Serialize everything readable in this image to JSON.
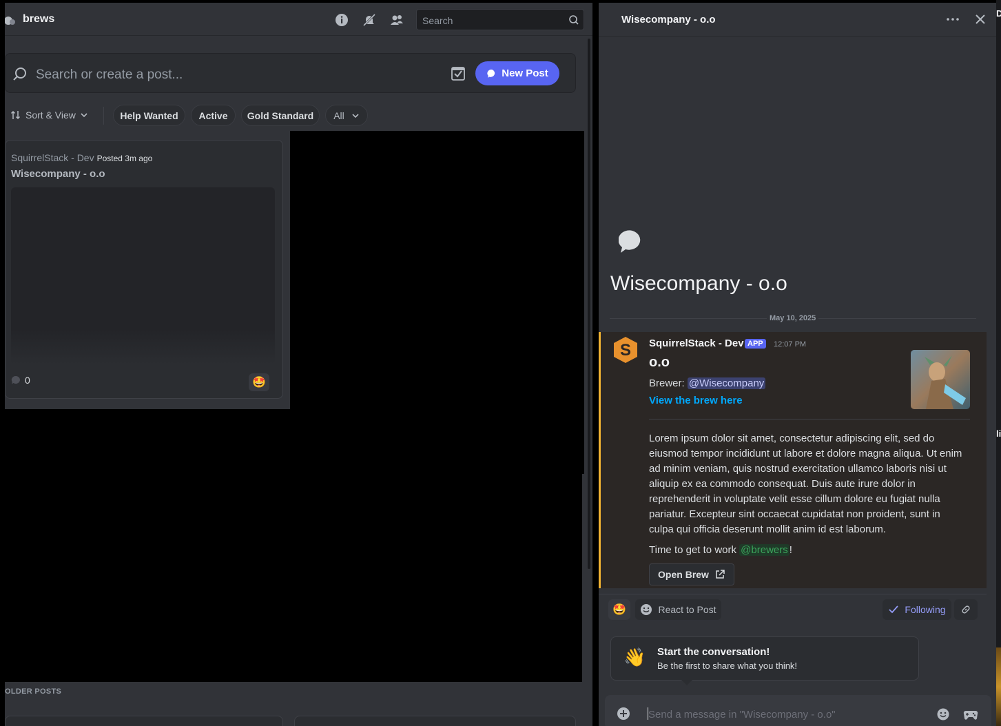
{
  "left": {
    "channel_name": "brews",
    "top_search_placeholder": "Search",
    "postbar_placeholder": "Search or create a post...",
    "new_post_label": "New Post",
    "sort_view_label": "Sort & View",
    "tags": [
      "Help Wanted",
      "Active",
      "Gold Standard",
      "All"
    ],
    "post": {
      "author": "SquirrelStack - Dev",
      "posted": "Posted 3m ago",
      "title": "Wisecompany - o.o",
      "comment_count": "0",
      "reaction_emoji": "🤩"
    },
    "older_posts_label": "OLDER POSTS"
  },
  "thread": {
    "header_title": "Wisecompany - o.o",
    "big_title": "Wisecompany - o.o",
    "date": "May 10, 2025",
    "message": {
      "author": "SquirrelStack - Dev",
      "badge": "APP",
      "time": "12:07 PM",
      "embed_title": "o.o",
      "brewer_label": "Brewer:",
      "brewer_mention": "@Wisecompany",
      "view_link": "View the brew here",
      "body": "Lorem ipsum dolor sit amet, consectetur adipiscing elit, sed do eiusmod tempor incididunt ut labore et dolore magna aliqua. Ut enim ad minim veniam, quis nostrud exercitation ullamco laboris nisi ut aliquip ex ea commodo consequat. Duis aute irure dolor in reprehenderit in voluptate velit esse cillum dolore eu fugiat nulla pariatur. Excepteur sint occaecat cupidatat non proident, sunt in culpa qui officia deserunt mollit anim id est laborum.",
      "ttg_prefix": "Time to get to work",
      "ttg_mention": "@brewers",
      "ttg_suffix": "!",
      "open_brew_label": "Open Brew"
    },
    "reaction_emoji": "🤩",
    "react_label": "React to Post",
    "following_label": "Following",
    "start_title": "Start the conversation!",
    "start_sub": "Be the first to share what you think!",
    "wave_emoji": "👋",
    "composer_placeholder": "Send a message in \"Wisecompany - o.o\""
  },
  "edge_letters": [
    "D",
    "li"
  ],
  "colors": {
    "accent": "#5865f2",
    "link": "#00a8fc",
    "embed_border": "#f0b232",
    "following": "#949cf7"
  }
}
